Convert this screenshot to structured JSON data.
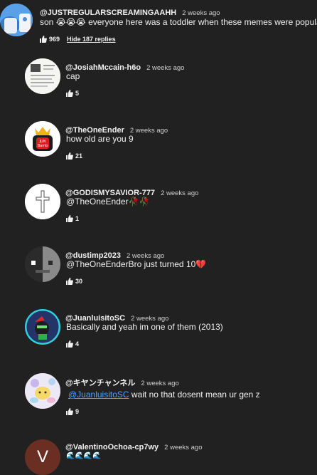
{
  "top_comment": {
    "author": "@JUSTREGULARSCREAMINGAAHH",
    "time": "2 weeks ago",
    "text_prefix": "son ",
    "emojis": "😭😭😭",
    "text_suffix": " everyone here was a toddler when these memes were popular",
    "likes": "969",
    "hide_replies": "Hide 187 replies"
  },
  "replies": [
    {
      "author": "@JosiahMccain-h6o",
      "time": "2 weeks ago",
      "text": "cap",
      "likes": "5"
    },
    {
      "author": "@TheOneEnder",
      "time": "2 weeks ago",
      "text": "how old are you 9",
      "likes": "21",
      "avatar_text": "JUN\nBamb"
    },
    {
      "author": "@GODISMYSAVIOR-777",
      "time": "2 weeks ago",
      "text": "@TheOneEnder🥀🥀",
      "likes": "1"
    },
    {
      "author": "@dustimp2023",
      "time": "2 weeks ago",
      "text": "@TheOneEnderBro just turned 10💔",
      "likes": "30"
    },
    {
      "author": "@JuanluisitoSC",
      "time": "2 weeks ago",
      "text": "Basically and yeah im one of them (2013)",
      "likes": "4"
    },
    {
      "author": "@キヤンチャンネル",
      "time": "2 weeks ago",
      "mention": "@JuanluisitoSC",
      "text": " wait no that dosent mean ur gen z",
      "likes": "9"
    },
    {
      "author": "@ValentinoOchoa-cp7wy",
      "time": "2 weeks ago",
      "text": "🌊🌊🌊🌊",
      "avatar_letter": "V"
    }
  ],
  "colors": {
    "background": "#212121",
    "mention": "#4aa3ff",
    "valentino_avatar": "#6b2e22"
  }
}
